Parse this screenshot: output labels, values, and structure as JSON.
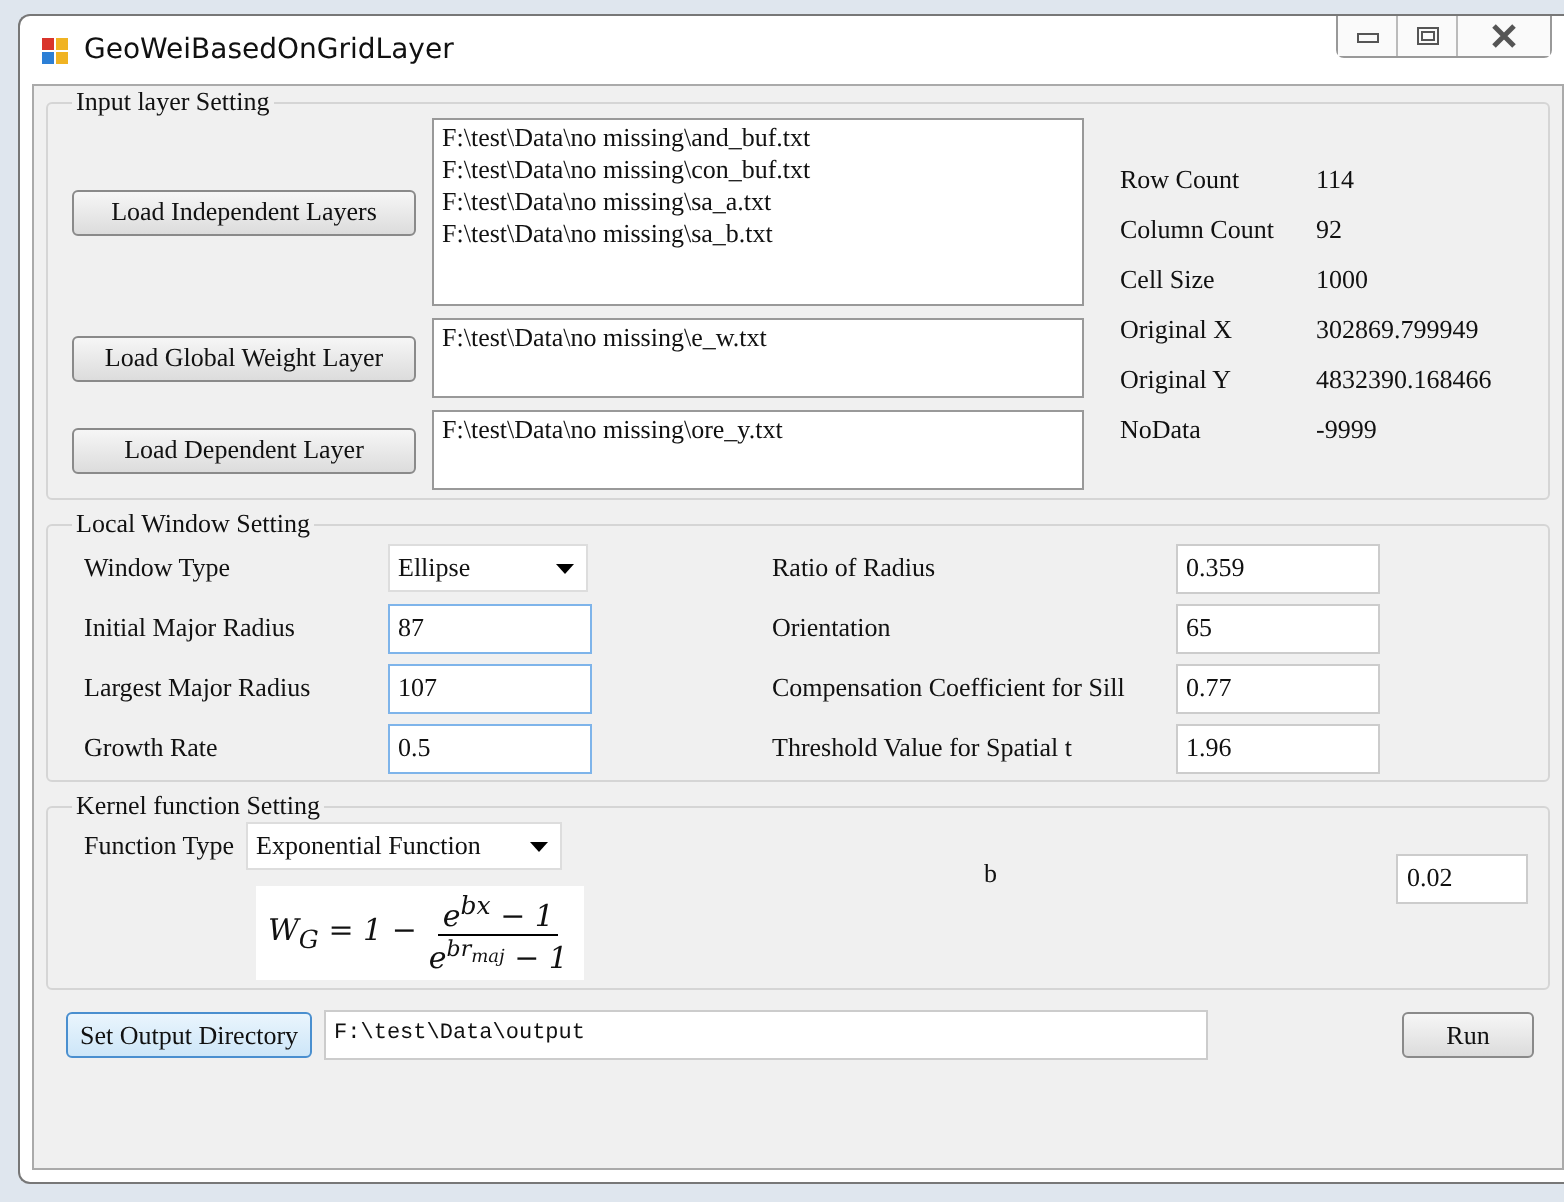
{
  "window": {
    "title": "GeoWeiBasedOnGridLayer"
  },
  "input_layer": {
    "title": "Input layer Setting",
    "loaders": [
      {
        "button": "Load Independent Layers",
        "files": [
          "F:\\test\\Data\\no missing\\and_buf.txt",
          "F:\\test\\Data\\no missing\\con_buf.txt",
          "F:\\test\\Data\\no missing\\sa_a.txt",
          "F:\\test\\Data\\no missing\\sa_b.txt"
        ],
        "kind": "tall"
      },
      {
        "button": "Load Global Weight Layer",
        "files": [
          "F:\\test\\Data\\no missing\\e_w.txt"
        ],
        "kind": "short"
      },
      {
        "button": "Load Dependent Layer",
        "files": [
          "F:\\test\\Data\\no missing\\ore_y.txt"
        ],
        "kind": "short"
      }
    ],
    "info": [
      {
        "label": "Row Count",
        "value": "114"
      },
      {
        "label": "Column Count",
        "value": "92"
      },
      {
        "label": "Cell Size",
        "value": "1000"
      },
      {
        "label": "Original X",
        "value": "302869.799949"
      },
      {
        "label": "Original Y",
        "value": "4832390.168466"
      },
      {
        "label": "NoData",
        "value": "-9999"
      }
    ]
  },
  "local_window": {
    "title": "Local Window Setting",
    "left": [
      {
        "label": "Window Type",
        "value": "Ellipse",
        "kind": "dropdown"
      },
      {
        "label": "Initial Major Radius",
        "value": "87",
        "kind": "field"
      },
      {
        "label": "Largest Major Radius",
        "value": "107",
        "kind": "field"
      },
      {
        "label": "Growth Rate",
        "value": "0.5",
        "kind": "field"
      }
    ],
    "right": [
      {
        "label": "Ratio of Radius",
        "value": "0.359"
      },
      {
        "label": "Orientation",
        "value": "65"
      },
      {
        "label": "Compensation Coefficient for Sill",
        "value": "0.77"
      },
      {
        "label": "Threshold Value for Spatial t",
        "value": "1.96"
      }
    ]
  },
  "kernel": {
    "title": "Kernel function Setting",
    "function_label": "Function Type",
    "function_value": "Exponential Function",
    "formula": {
      "lhs": "W$_{G}$ = 1 −",
      "numerator": "e$^{bx}$ − 1",
      "denominator_base": "e",
      "denominator_exp": "br",
      "denominator_exp_sub": "maj",
      "denominator_tail": "− 1"
    },
    "b_label": "b",
    "b_value": "0.02"
  },
  "output": {
    "button": "Set Output Directory",
    "path": "F:\\test\\Data\\output",
    "run": "Run"
  }
}
